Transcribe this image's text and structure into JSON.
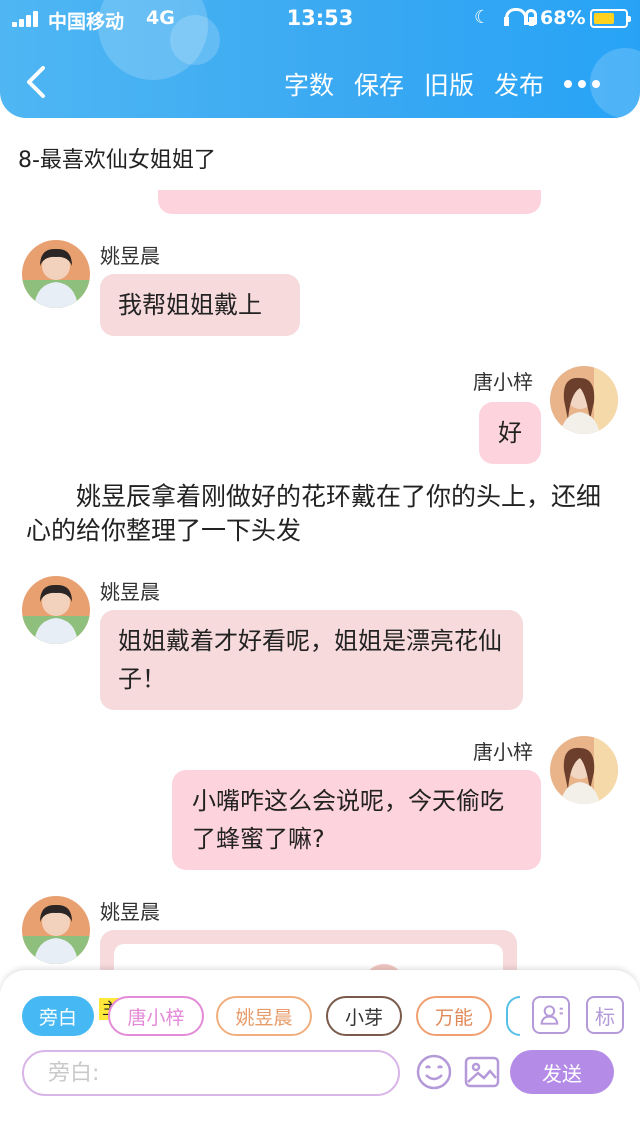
{
  "status_bar": {
    "carrier": "中国移动",
    "network": "4G",
    "time": "13:53",
    "battery": "68%",
    "battery_level": 0.68
  },
  "header": {
    "actions": [
      "字数",
      "保存",
      "旧版",
      "发布"
    ]
  },
  "story": {
    "title": "8-最喜欢仙女姐姐了"
  },
  "feed": {
    "messages": [
      {
        "speaker": "姚昱晨",
        "side": "left",
        "text": "我帮姐姐戴上"
      },
      {
        "speaker": "唐小梓",
        "side": "right",
        "text": "好"
      },
      {
        "narration": "姚昱辰拿着刚做好的花环戴在了你的头上，还细心的给你整理了一下头发"
      },
      {
        "speaker": "姚昱晨",
        "side": "left",
        "text": "姐姐戴着才好看呢，姐姐是漂亮花仙子！"
      },
      {
        "speaker": "唐小梓",
        "side": "right",
        "text": "小嘴咋这么会说呢，今天偷吃了蜂蜜了嘛?"
      },
      {
        "speaker": "姚昱晨",
        "side": "left",
        "text": ""
      }
    ]
  },
  "composer": {
    "role_badge": "主",
    "chips": [
      {
        "label": "旁白",
        "color": "#46b8f3"
      },
      {
        "label": "唐小梓",
        "color": "#e58ad8"
      },
      {
        "label": "姚昱晨",
        "color": "#f1ae7e"
      },
      {
        "label": "小芽",
        "color": "#7a5a4a"
      },
      {
        "label": "万能",
        "color": "#f0a070"
      }
    ],
    "tool_label": "标",
    "input_placeholder": "旁白:",
    "send_label": "发送"
  }
}
